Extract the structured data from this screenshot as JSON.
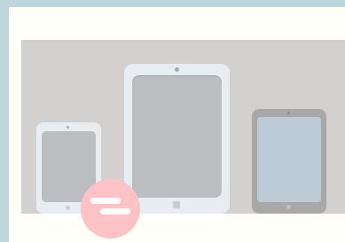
{
  "scene": {
    "devices": [
      "small-white-tablet",
      "large-white-tablet",
      "dark-gray-tablet"
    ],
    "badge_icon": "menu-lines-icon"
  },
  "colors": {
    "frame": "#bdd6dc",
    "card": "#fffef8",
    "stage": "#d3d1d0",
    "badge": "#fdc2c6",
    "tablet_white": "#e8edf1",
    "tablet_dark": "#a9a8a9"
  }
}
